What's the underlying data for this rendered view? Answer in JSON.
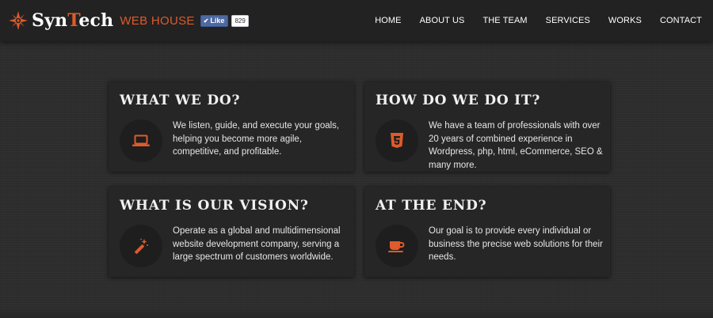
{
  "header": {
    "brand_part1": "Syn",
    "brand_part2": "T",
    "brand_part3": "ech",
    "brand_sub": "WEB HOUSE",
    "fb_like_label": "Like",
    "fb_like_count": "829",
    "logo_icon": "star-compass-icon"
  },
  "nav": {
    "items": [
      {
        "label": "HOME"
      },
      {
        "label": "ABOUT US"
      },
      {
        "label": "THE TEAM"
      },
      {
        "label": "SERVICES"
      },
      {
        "label": "WORKS"
      },
      {
        "label": "CONTACT"
      }
    ]
  },
  "cards": [
    {
      "title": "WHAT WE DO?",
      "icon": "laptop-icon",
      "text": "We listen, guide, and execute your goals, helping you become more agile, competitive, and profitable."
    },
    {
      "title": "HOW DO WE DO IT?",
      "icon": "html5-icon",
      "text": "We have a team of professionals with over 20 years of combined experience in Wordpress, php, html, eCommerce, SEO & many more."
    },
    {
      "title": "WHAT IS OUR VISION?",
      "icon": "magic-wand-icon",
      "text": "Operate as a global and multidimensional website development company, serving a large spectrum of customers worldwide."
    },
    {
      "title": "AT THE END?",
      "icon": "coffee-cup-icon",
      "text": "Our goal is to provide every individual or business the precise web solutions for their needs."
    }
  ],
  "colors": {
    "accent": "#e05a2b",
    "navbar": "#222222",
    "card": "#262626",
    "background": "#2d2d2d"
  }
}
